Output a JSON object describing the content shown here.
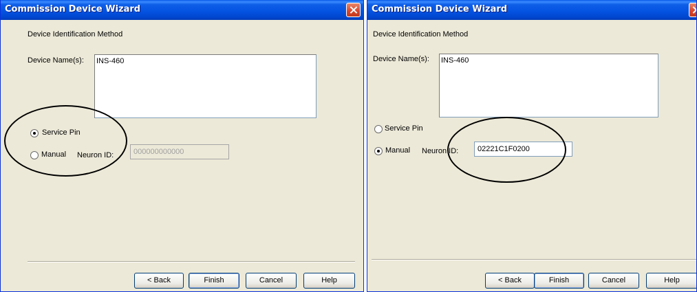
{
  "left_dialog": {
    "title": "Commission Device Wizard",
    "section_label": "Device Identification Method",
    "device_names_label": "Device Name(s):",
    "device_names_value": "INS-460",
    "service_pin_label": "Service Pin",
    "manual_label": "Manual",
    "neuron_id_label": "Neuron ID:",
    "neuron_id_value": "000000000000",
    "selected_option": "Service Pin",
    "buttons": {
      "back": "< Back",
      "finish": "Finish",
      "cancel": "Cancel",
      "help": "Help"
    }
  },
  "right_dialog": {
    "title": "Commission Device Wizard",
    "section_label": "Device Identification Method",
    "device_names_label": "Device Name(s):",
    "device_names_value": "INS-460",
    "service_pin_label": "Service Pin",
    "manual_label": "Manual",
    "neuron_id_label": "Neuron ID:",
    "neuron_id_value": "02221C1F0200",
    "selected_option": "Manual",
    "buttons": {
      "back": "< Back",
      "finish": "Finish",
      "cancel": "Cancel",
      "help": "Help"
    }
  },
  "colors": {
    "title_bar": "#0553e2",
    "dialog_background": "#ece9d8",
    "close_button": "#d9452b",
    "annotation_outline": "#000000"
  },
  "icons": [
    "close-icon"
  ]
}
